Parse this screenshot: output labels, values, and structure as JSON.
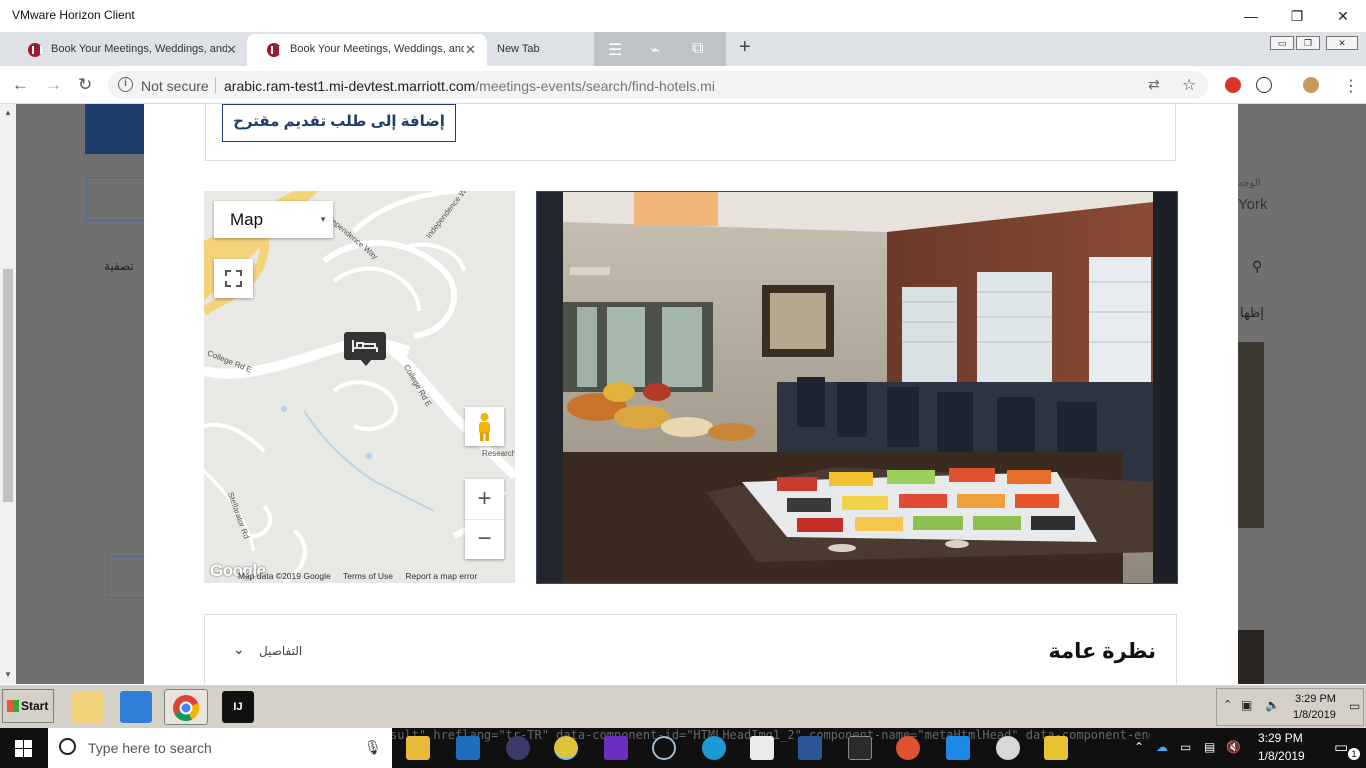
{
  "window": {
    "title": "VMware Horizon Client"
  },
  "tabs": [
    {
      "label": "Book Your Meetings, Weddings, and",
      "active": false
    },
    {
      "label": "Book Your Meetings, Weddings, and",
      "active": true
    },
    {
      "label": "New Tab",
      "active": false
    }
  ],
  "addressbar": {
    "security": "Not secure",
    "host": "arabic.ram-test1.mi-devtest.marriott.com",
    "path": "/meetings-events/search/find-hotels.mi"
  },
  "page": {
    "add_to_rfp_button": "إضافة إلى طلب تقديم مقترح",
    "map": {
      "type_label": "Map",
      "streets": [
        "College Rd E",
        "College Rd E",
        "Independence Way",
        "Independence W",
        "Research",
        "Stellarator Rd"
      ],
      "footer": [
        "Map data ©2019 Google",
        "Terms of Use",
        "Report a map error"
      ],
      "google_logo": "Google"
    },
    "overview": {
      "title": "نظرة عامة",
      "details_label": "التفاصيل"
    },
    "background_fragments": [
      "تصفية",
      "إظها",
      "York",
      "الوجه"
    ]
  },
  "vm_taskbar": {
    "start": "Start",
    "time": "3:29 PM",
    "date": "1/8/2019"
  },
  "win_taskbar": {
    "search_placeholder": "Type here to search",
    "time": "3:29 PM",
    "date": "1/8/2019",
    "notification_count": "1",
    "background_text": "sult\" hreflang=\"tr-TR\" data-component-id=\"HTMLHeadImg1_2\" component-name=\"metaHtmlHead\" data-component-endpoint=\"/mi/"
  },
  "colors": {
    "brand_navy": "#1c3f6e",
    "tab_bg": "#dee1e6",
    "taskbar_win": "#101010",
    "taskbar_vm": "#d4d0c8"
  }
}
